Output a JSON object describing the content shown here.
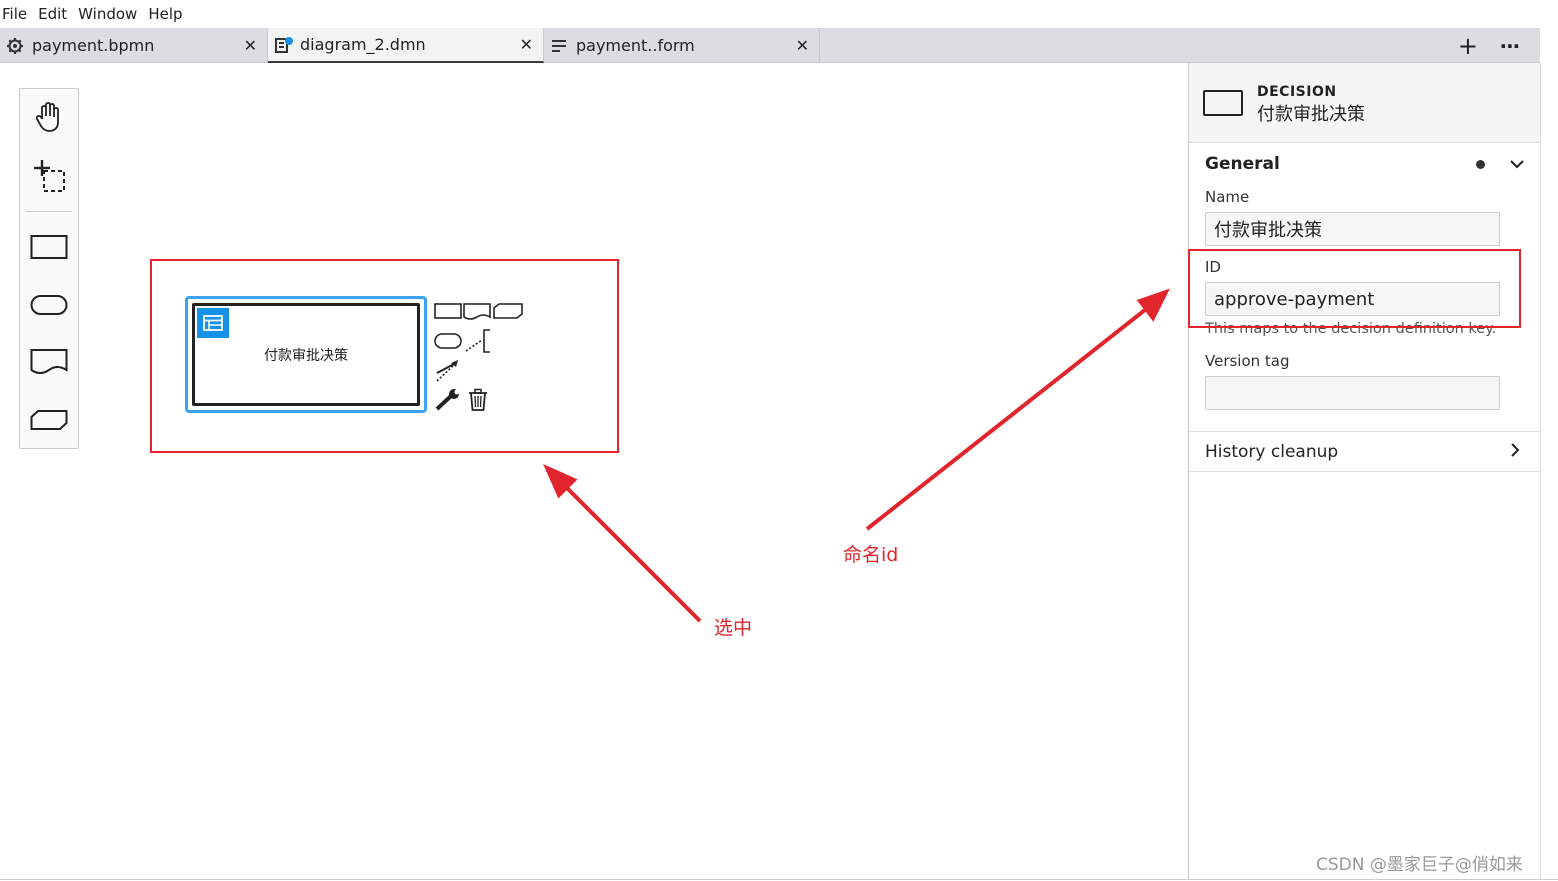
{
  "menu": [
    "File",
    "Edit",
    "Window",
    "Help"
  ],
  "tabs": [
    {
      "label": "payment.bpmn",
      "icon": "gear-icon"
    },
    {
      "label": "diagram_2.dmn",
      "icon": "dmn-file-icon"
    },
    {
      "label": "payment..form",
      "icon": "form-file-icon"
    }
  ],
  "tab_close": "✕",
  "tab_actions": {
    "add": "+",
    "more": "⋯"
  },
  "decision": {
    "label": "付款审批决策"
  },
  "annotations": {
    "selected": "选中",
    "name_id": "命名id"
  },
  "panel": {
    "element_type": "DECISION",
    "element_name": "付款审批决策",
    "general": {
      "title": "General",
      "name_label": "Name",
      "name_value": "付款审批决策",
      "id_label": "ID",
      "id_value": "approve-payment",
      "id_desc": "This maps to the decision definition key.",
      "version_label": "Version tag",
      "version_value": ""
    },
    "history": {
      "title": "History cleanup"
    }
  },
  "watermark": "CSDN @墨家巨子@俏如来",
  "colors": {
    "accent": "#1591e8",
    "annotation": "#e2242c"
  }
}
